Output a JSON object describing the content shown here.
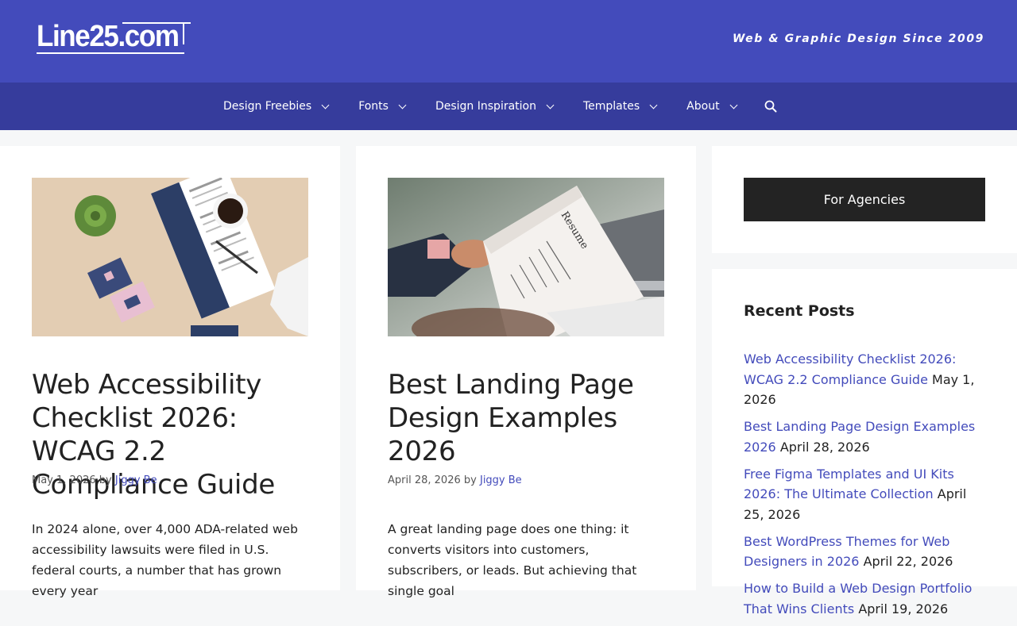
{
  "header": {
    "logo_text": "Line25.com",
    "tagline": "Web & Graphic Design Since 2009"
  },
  "nav": {
    "items": [
      {
        "label": "Design Freebies",
        "icon": "chevron-down-icon"
      },
      {
        "label": "Fonts",
        "icon": "chevron-down-icon"
      },
      {
        "label": "Design Inspiration",
        "icon": "chevron-down-icon"
      },
      {
        "label": "Templates",
        "icon": "chevron-down-icon"
      },
      {
        "label": "About",
        "icon": "chevron-down-icon"
      }
    ],
    "search_icon": "search-icon"
  },
  "posts": [
    {
      "title": "Web Accessibility Checklist 2026: WCAG 2.2 Compliance Guide",
      "date": "May 1, 2026",
      "by": "by",
      "author": "Jiggy Be",
      "excerpt": "In 2024 alone, over 4,000 ADA-related web accessibility lawsuits were filed in U.S. federal courts, a number that has grown every year"
    },
    {
      "title": "Best Landing Page Design Examples 2026",
      "date": "April 28, 2026",
      "by": "by",
      "author": "Jiggy Be",
      "excerpt": "A great landing page does one thing: it converts visitors into customers, subscribers, or leads. But achieving that single goal"
    }
  ],
  "sidebar": {
    "agencies_button": "For Agencies",
    "recent_title": "Recent Posts",
    "recent_posts": [
      {
        "title": "Web Accessibility Checklist 2026: WCAG 2.2 Compliance Guide",
        "date": "May 1, 2026"
      },
      {
        "title": "Best Landing Page Design Examples 2026",
        "date": "April 28, 2026"
      },
      {
        "title": "Free Figma Templates and UI Kits 2026: The Ultimate Collection",
        "date": "April 25, 2026"
      },
      {
        "title": "Best WordPress Themes for Web Designers in 2026",
        "date": "April 22, 2026"
      },
      {
        "title": "How to Build a Web Design Portfolio That Wins Clients",
        "date": "April 19, 2026"
      }
    ]
  },
  "colors": {
    "header_bg": "#434bbb",
    "nav_bg": "#363c9c",
    "link": "#434bbb",
    "button_bg": "#232323"
  }
}
